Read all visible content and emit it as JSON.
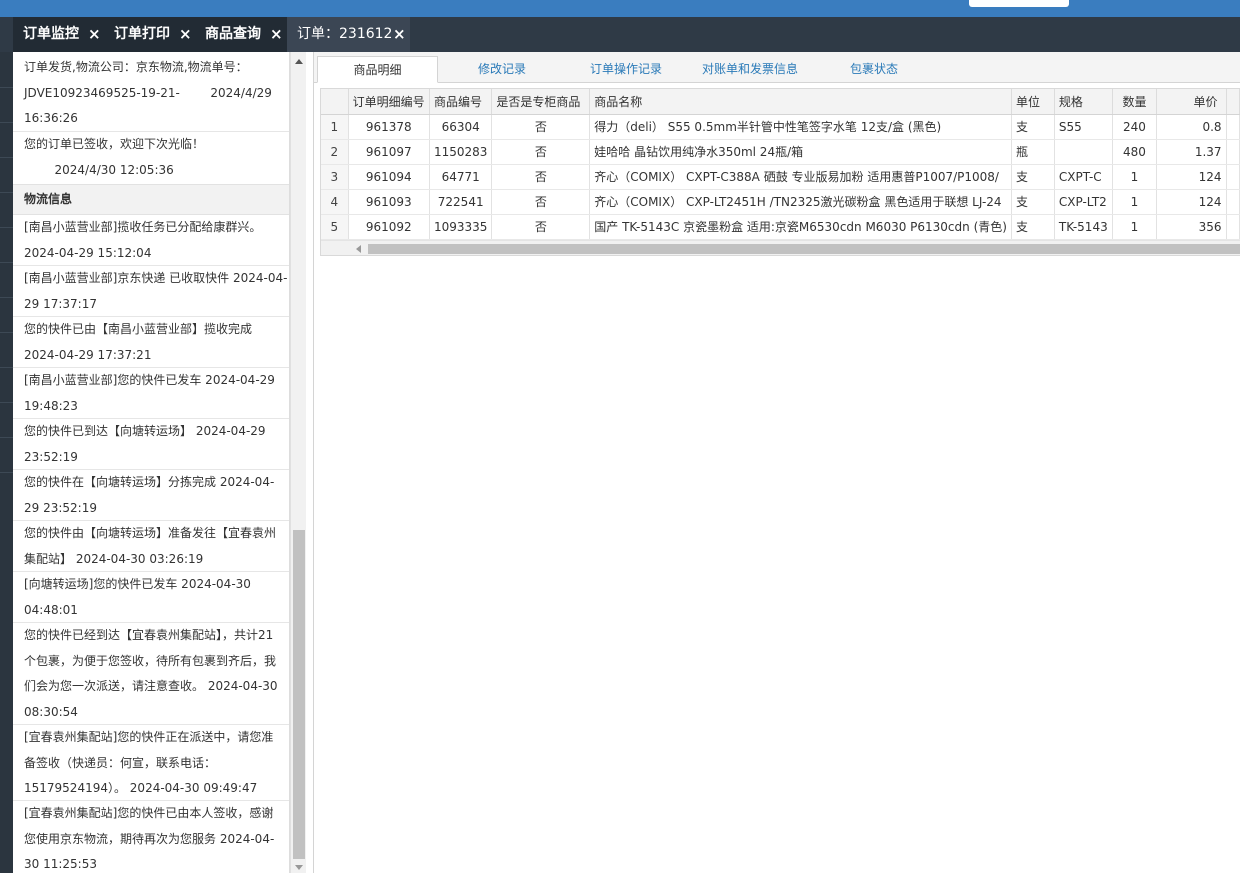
{
  "header_tabs": [
    {
      "label": "订单监控"
    },
    {
      "label": "订单打印"
    },
    {
      "label": "商品查询"
    },
    {
      "label": "订单：231612"
    }
  ],
  "close_glyph": "×",
  "order_log": [
    {
      "lines": [
        "订单发货,物流公司：京东物流,物流单号：",
        "JDVE10923469525-19-21-        2024/4/29",
        "16:36:26"
      ]
    },
    {
      "lines": [
        "您的订单已签收，欢迎下次光临！",
        "        2024/4/30 12:05:36"
      ]
    }
  ],
  "logistics_header": "物流信息",
  "logistics": [
    {
      "lines": [
        "[南昌小蓝营业部]揽收任务已分配给康群兴。",
        "2024-04-29 15:12:04"
      ]
    },
    {
      "lines": [
        "[南昌小蓝营业部]京东快递 已收取快件 2024-04-",
        "29 17:37:17"
      ]
    },
    {
      "lines": [
        "您的快件已由【南昌小蓝营业部】揽收完成",
        "2024-04-29 17:37:21"
      ]
    },
    {
      "lines": [
        "[南昌小蓝营业部]您的快件已发车 2024-04-29",
        "19:48:23"
      ]
    },
    {
      "lines": [
        "您的快件已到达【向塘转运场】 2024-04-29",
        "23:52:19"
      ]
    },
    {
      "lines": [
        "您的快件在【向塘转运场】分拣完成 2024-04-",
        "29 23:52:19"
      ]
    },
    {
      "lines": [
        "您的快件由【向塘转运场】准备发往【宜春袁州",
        "集配站】 2024-04-30 03:26:19"
      ]
    },
    {
      "lines": [
        "[向塘转运场]您的快件已发车 2024-04-30",
        "04:48:01"
      ]
    },
    {
      "lines": [
        "您的快件已经到达【宜春袁州集配站】，共计21",
        "个包裹，为便于您签收，待所有包裹到齐后，我",
        "们会为您一次派送，请注意查收。 2024-04-30",
        "08:30:54"
      ]
    },
    {
      "lines": [
        "[宜春袁州集配站]您的快件正在派送中，请您准",
        "备签收（快递员：何宣，联系电话：",
        "15179524194）。 2024-04-30 09:49:47"
      ]
    },
    {
      "lines": [
        "[宜春袁州集配站]您的快件已由本人签收，感谢",
        "您使用京东物流，期待再次为您服务 2024-04-",
        "30 11:25:53"
      ]
    }
  ],
  "sub_tabs": [
    {
      "label": "商品明细",
      "active": true
    },
    {
      "label": "修改记录"
    },
    {
      "label": "订单操作记录"
    },
    {
      "label": "对账单和发票信息"
    },
    {
      "label": "包裹状态"
    }
  ],
  "table": {
    "columns": [
      "",
      "订单明细编号",
      "商品编号",
      "是否是专柜商品",
      "商品名称",
      "单位",
      "规格",
      "数量",
      "单价",
      ""
    ],
    "rows": [
      {
        "n": "1",
        "detail_id": "961378",
        "sku": "66304",
        "counter": "否",
        "name": "得力（deli） S55 0.5mm半针管中性笔签字水笔 12支/盒 (黑色)",
        "unit": "支",
        "spec": "S55",
        "qty": "240",
        "price": "0.8"
      },
      {
        "n": "2",
        "detail_id": "961097",
        "sku": "1150283",
        "counter": "否",
        "name": "娃哈哈 晶钻饮用纯净水350ml 24瓶/箱",
        "unit": "瓶",
        "spec": "",
        "qty": "480",
        "price": "1.37"
      },
      {
        "n": "3",
        "detail_id": "961094",
        "sku": "64771",
        "counter": "否",
        "name": "齐心（COMIX） CXPT-C388A 硒鼓 专业版易加粉 适用惠普P1007/P1008/",
        "unit": "支",
        "spec": "CXPT-C",
        "qty": "1",
        "price": "124"
      },
      {
        "n": "4",
        "detail_id": "961093",
        "sku": "722541",
        "counter": "否",
        "name": "齐心（COMIX） CXP-LT2451H /TN2325激光碳粉盒 黑色适用于联想 LJ-24",
        "unit": "支",
        "spec": "CXP-LT2",
        "qty": "1",
        "price": "124"
      },
      {
        "n": "5",
        "detail_id": "961092",
        "sku": "1093335",
        "counter": "否",
        "name": "国产 TK-5143C 京瓷墨粉盒 适用:京瓷M6530cdn M6030 P6130cdn (青色)",
        "unit": "支",
        "spec": "TK-5143",
        "qty": "1",
        "price": "356"
      }
    ]
  },
  "colors": {
    "top_bar": "#3a7dbf",
    "tab_strip": "#2f3a46",
    "link": "#1f2fc8",
    "subtab_link": "#2a7ab8"
  }
}
